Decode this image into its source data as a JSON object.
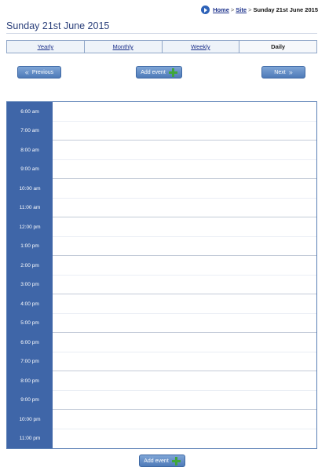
{
  "breadcrumb": {
    "home": "Home",
    "site": "Site",
    "separator": ">",
    "current": "Sunday 21st June 2015"
  },
  "page": {
    "title": "Sunday 21st June 2015"
  },
  "tabs": [
    {
      "label": "Yearly",
      "active": false
    },
    {
      "label": "Monthly",
      "active": false
    },
    {
      "label": "Weekly",
      "active": false
    },
    {
      "label": "Daily",
      "active": true
    }
  ],
  "nav": {
    "previous_label": "Previous",
    "add_event_label": "Add event",
    "next_label": "Next"
  },
  "hours": [
    "6:00 am",
    "7:00 am",
    "8:00 am",
    "9:00 am",
    "10:00 am",
    "11:00 am",
    "12:00 pm",
    "1:00 pm",
    "2:00 pm",
    "3:00 pm",
    "4:00 pm",
    "5:00 pm",
    "6:00 pm",
    "7:00 pm",
    "8:00 pm",
    "9:00 pm",
    "10:00 pm",
    "11:00 pm"
  ],
  "footer": {
    "add_event_label": "Add event"
  },
  "colors": {
    "accent": "#3f66a8",
    "link": "#1a2f8a",
    "add_icon": "#3fa63a"
  }
}
